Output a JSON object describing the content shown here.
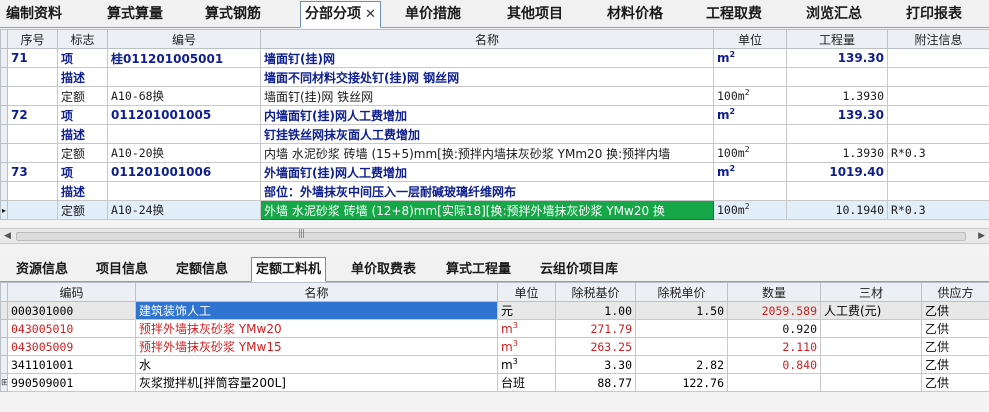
{
  "top_tabs": [
    {
      "label": "编制资料"
    },
    {
      "label": "算式算量"
    },
    {
      "label": "算式钢筋"
    },
    {
      "label": "分部分项",
      "active": true
    },
    {
      "label": "单价措施"
    },
    {
      "label": "其他项目"
    },
    {
      "label": "材料价格"
    },
    {
      "label": "工程取费"
    },
    {
      "label": "浏览汇总"
    },
    {
      "label": "打印报表"
    }
  ],
  "close_glyph": "✕",
  "upper": {
    "columns": [
      "序号",
      "标志",
      "编号",
      "名称",
      "单位",
      "工程量",
      "附注信息"
    ],
    "rows": [
      {
        "kind": "item",
        "seq": "71",
        "flag": "项",
        "code": "桂011201005001",
        "name": "墙面钉(挂)网",
        "unit": "m",
        "unit_sup": "2",
        "qty": "139.30",
        "note": ""
      },
      {
        "kind": "desc",
        "seq": "",
        "flag": "描述",
        "code": "",
        "name": "墙面不同材料交接处钉(挂)网 钢丝网",
        "unit": "",
        "unit_sup": "",
        "qty": "",
        "note": ""
      },
      {
        "kind": "quota",
        "seq": "",
        "flag": "定额",
        "code": "A10-68换",
        "name": "墙面钉(挂)网 铁丝网",
        "unit": "100m",
        "unit_sup": "2",
        "qty": "1.3930",
        "note": ""
      },
      {
        "kind": "item",
        "seq": "72",
        "flag": "项",
        "code": "011201001005",
        "name": "内墙面钉(挂)网人工费增加",
        "unit": "m",
        "unit_sup": "2",
        "qty": "139.30",
        "note": ""
      },
      {
        "kind": "desc",
        "seq": "",
        "flag": "描述",
        "code": "",
        "name": "钉挂铁丝网抹灰面人工费增加",
        "unit": "",
        "unit_sup": "",
        "qty": "",
        "note": ""
      },
      {
        "kind": "quota",
        "seq": "",
        "flag": "定额",
        "code": "A10-20换",
        "name": "内墙 水泥砂浆 砖墙 (15+5)mm[换:预拌内墙抹灰砂浆 YMm20 换:预拌内墙",
        "unit": "100m",
        "unit_sup": "2",
        "qty": "1.3930",
        "note": "R*0.3"
      },
      {
        "kind": "item",
        "seq": "73",
        "flag": "项",
        "code": "011201001006",
        "name": "外墙面钉(挂)网人工费增加",
        "unit": "m",
        "unit_sup": "2",
        "qty": "1019.40",
        "note": ""
      },
      {
        "kind": "desc",
        "seq": "",
        "flag": "描述",
        "code": "",
        "name": "部位：外墙抹灰中间压入一层耐碱玻璃纤维网布",
        "unit": "",
        "unit_sup": "",
        "qty": "",
        "note": ""
      },
      {
        "kind": "quota",
        "selected": true,
        "seq": "",
        "flag": "定额",
        "code": "A10-24换",
        "name": "外墙 水泥砂浆 砖墙 (12+8)mm[实际18][换:预拌外墙抹灰砂浆 YMw20 换",
        "unit": "100m",
        "unit_sup": "2",
        "qty": "10.1940",
        "note": "R*0.3"
      }
    ]
  },
  "bottom_tabs": [
    {
      "label": "资源信息"
    },
    {
      "label": "项目信息"
    },
    {
      "label": "定额信息"
    },
    {
      "label": "定额工料机",
      "active": true
    },
    {
      "label": "单价取费表"
    },
    {
      "label": "算式工程量"
    },
    {
      "label": "云组价项目库"
    }
  ],
  "lower": {
    "columns": [
      "编码",
      "名称",
      "单位",
      "除税基价",
      "除税单价",
      "数量",
      "三材",
      "供应方"
    ],
    "rows": [
      {
        "code": "000301000",
        "name": "建筑装饰人工",
        "unit": "元",
        "unit_sup": "",
        "base": "1.00",
        "price": "1.50",
        "qty": "2059.589",
        "mat": "人工费(元)",
        "supplier": "乙供",
        "red": false,
        "highlight": true
      },
      {
        "code": "043005010",
        "name": "预拌外墙抹灰砂浆 YMw20",
        "unit": "m",
        "unit_sup": "3",
        "base": "271.79",
        "price": "",
        "qty": "0.920",
        "mat": "",
        "supplier": "乙供",
        "red": true
      },
      {
        "code": "043005009",
        "name": "预拌外墙抹灰砂浆 YMw15",
        "unit": "m",
        "unit_sup": "3",
        "base": "263.25",
        "price": "",
        "qty": "2.110",
        "mat": "",
        "supplier": "乙供",
        "red": true
      },
      {
        "code": "341101001",
        "name": "水",
        "unit": "m",
        "unit_sup": "3",
        "base": "3.30",
        "price": "2.82",
        "qty": "0.840",
        "mat": "",
        "supplier": "乙供",
        "red": false
      },
      {
        "code": "990509001",
        "name": "灰浆搅拌机[拌筒容量200L]",
        "unit": "台班",
        "unit_sup": "",
        "base": "88.77",
        "price": "122.76",
        "qty": "",
        "mat": "",
        "supplier": "乙供",
        "red": false,
        "expandable": true
      }
    ]
  },
  "colors": {
    "item_text": "#0f1f8f",
    "selection_green": "#16a848",
    "highlight_blue": "#2f74d0",
    "red_text": "#d21e1e"
  },
  "icons": [
    "close-icon",
    "row-pointer-icon",
    "expand-icon",
    "scroll-left-icon",
    "scroll-right-icon"
  ]
}
